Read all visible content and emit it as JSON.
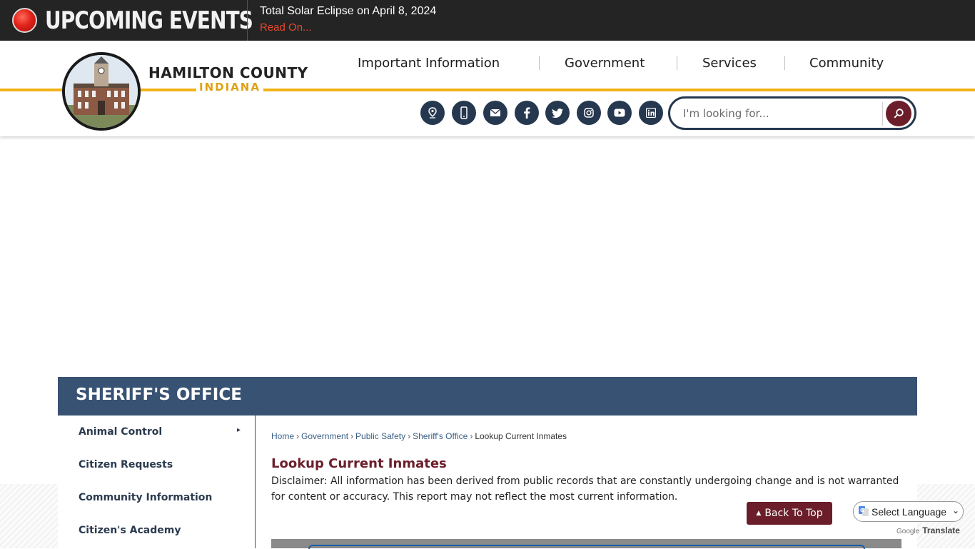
{
  "alert": {
    "title": "UPCOMING EVENTS",
    "headline": "Total Solar Eclipse on April 8, 2024",
    "link": "Read On..."
  },
  "logo": {
    "name": "HAMILTON COUNTY",
    "state": "INDIANA"
  },
  "nav": {
    "items": [
      "Important Information",
      "Government",
      "Services",
      "Community"
    ]
  },
  "social": {
    "icons": [
      "map-pin-icon",
      "mobile-icon",
      "email-icon",
      "facebook-icon",
      "twitter-icon",
      "instagram-icon",
      "youtube-icon",
      "linkedin-icon"
    ]
  },
  "search": {
    "placeholder": "I'm looking for..."
  },
  "department": {
    "title": "SHERIFF'S OFFICE"
  },
  "sidebar": {
    "items": [
      {
        "label": "Animal Control",
        "has_submenu": true
      },
      {
        "label": "Citizen Requests",
        "has_submenu": false
      },
      {
        "label": "Community Information",
        "has_submenu": false
      },
      {
        "label": "Citizen's Academy",
        "has_submenu": false
      }
    ]
  },
  "breadcrumb": {
    "items": [
      "Home",
      "Government",
      "Public Safety",
      "Sheriff's Office"
    ],
    "current": "Lookup Current Inmates"
  },
  "page": {
    "heading": "Lookup Current Inmates",
    "disclaimer": "Disclaimer: All information has been derived from public records that are constantly undergoing change and is not warranted for content or accuracy. This report may not reflect the most current information."
  },
  "back_to_top": "Back To Top",
  "translate": {
    "select_label": "Select Language",
    "powered_by": "Google",
    "translate_word": "Translate"
  },
  "colors": {
    "alert_bg": "#242424",
    "gold": "#f2b316",
    "navy": "#385273",
    "maroon": "#6b1e2a",
    "link_red": "#e8492c"
  }
}
